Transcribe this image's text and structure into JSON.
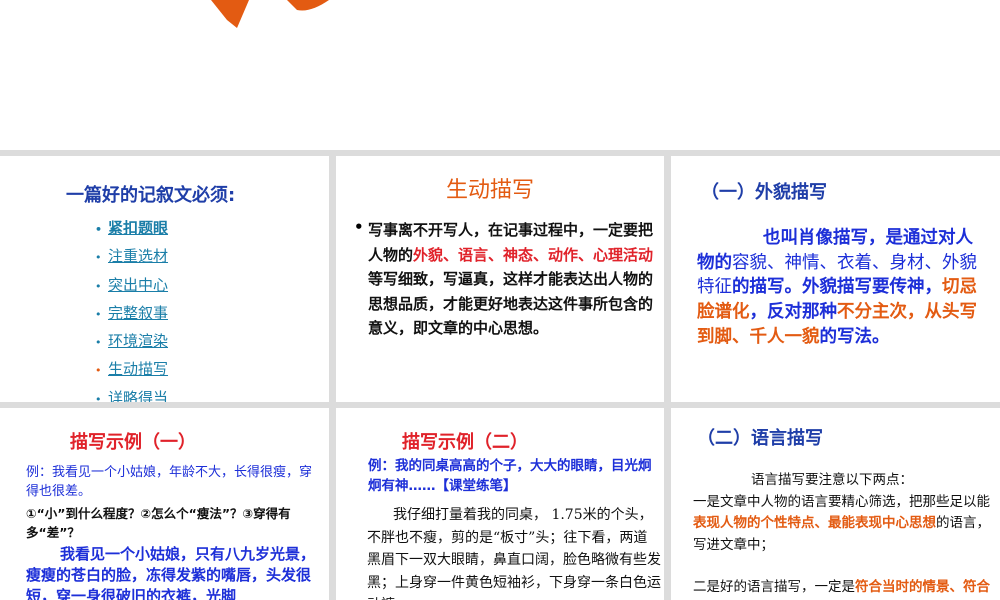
{
  "panel1": {
    "heading": "一篇好的记叙文必须:",
    "items": [
      "紧扣题眼",
      "注重选材",
      "突出中心",
      "完整叙事",
      "环境渲染",
      "生动描写",
      "详略得当"
    ]
  },
  "panel2": {
    "title": "生动描写",
    "bullet": "•",
    "text_a": "写事离不开写人，在记事过程中，一定要把人物的",
    "text_red": "外貌、语言、神态、动作、心理活动",
    "text_b": "等写细致，写逼真，这样才能表达出人物的思想品质，才能更好地表达这件事所包含的意义，即文章的中心思想。"
  },
  "panel3": {
    "title": "（一）外貌描写",
    "text_a": "也叫肖像描写，是通过对人物的",
    "text_b": "容貌、神情、衣着、身材、外貌特征",
    "text_c": "的描写。外貌描写要传神，",
    "text_red": "切忌脸谱化",
    "text_d": "，反对那种",
    "text_red2": "不分主次，从头写到脚、千人一貌",
    "text_e": "的写法。"
  },
  "panel4": {
    "title": "描写示例（一）",
    "example": "例：我看见一个小姑娘，年龄不大，长得很瘦，穿得也很差。",
    "questions": "①“小”到什么程度？②怎么个“瘦法”？③穿得有多“差”？",
    "body": "我看见一个小姑娘，只有八九岁光景，瘦瘦的苍白的脸，冻得发紫的嘴唇，头发很短，穿一身很破旧的衣裤，光脚"
  },
  "panel5": {
    "title": "描写示例（二）",
    "example_a": "例：我的同桌高高的个子，大大的眼睛，目光炯炯有神……",
    "example_b": "【课堂练笔】",
    "body": "我仔细打量着我的同桌， 1.75米的个头，不胖也不瘦，剪的是“板寸”头；往下看，两道黑眉下一双大眼睛，鼻直口阔，脸色略微有些发黑；上身穿一件黄色短袖衫，下身穿一条白色运动裤，"
  },
  "panel6": {
    "title": "（二）语言描写",
    "intro": "语言描写要注意以下两点：",
    "p1_a": "一是文章中人物的语言要精心筛选，把那些足以能",
    "p1_red": "表现人物的个性特点、最能表现中心思想",
    "p1_b": "的语言，写进文章中；",
    "p2_a": "二是好的语言描写，一定是",
    "p2_red": "符合当时的情景、符合人物的性格、身份、性别"
  },
  "colors": {
    "accent_orange": "#e35b12",
    "heading_blue": "#1f3ea8",
    "text_blue": "#1d2fd8",
    "red": "#e0222a",
    "link": "#1a7ea8"
  }
}
